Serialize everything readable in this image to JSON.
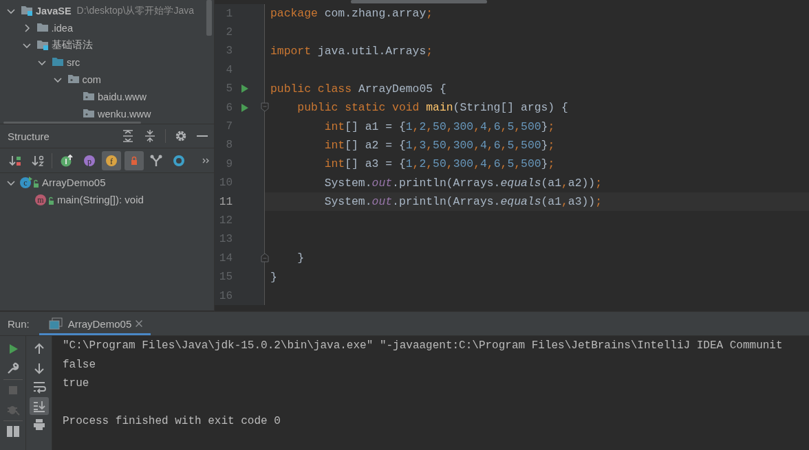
{
  "project_tree": {
    "items": [
      {
        "name": "JavaSE",
        "path": "D:\\desktop\\从零开始学Java",
        "kind": "module",
        "expanded": true,
        "children": [
          {
            "name": ".idea",
            "kind": "folder",
            "expanded": false
          },
          {
            "name": "基础语法",
            "kind": "module",
            "expanded": true,
            "children": [
              {
                "name": "src",
                "kind": "source",
                "expanded": true,
                "children": [
                  {
                    "name": "com",
                    "kind": "package",
                    "expanded": true,
                    "children": [
                      {
                        "name": "baidu.www",
                        "kind": "package"
                      },
                      {
                        "name": "wenku.www",
                        "kind": "package"
                      }
                    ]
                  }
                ]
              }
            ]
          }
        ]
      }
    ]
  },
  "structure": {
    "title": "Structure",
    "toolbar": [
      {
        "kind": "sort-visibility",
        "selected": false
      },
      {
        "kind": "sort-alpha",
        "selected": false
      },
      {
        "kind": "inherited",
        "selected": false
      },
      {
        "kind": "properties",
        "glyph": "p",
        "selected": false
      },
      {
        "kind": "fields",
        "glyph": "f",
        "selected": true
      },
      {
        "kind": "non-public",
        "selected": true
      },
      {
        "kind": "anonymous",
        "selected": false
      },
      {
        "kind": "lambdas",
        "selected": false
      }
    ],
    "tree": [
      {
        "name": "ArrayDemo05",
        "kind": "class",
        "glyph": "c",
        "expanded": true,
        "children": [
          {
            "name": "main(String[]): void",
            "kind": "method",
            "glyph": "m"
          }
        ]
      }
    ]
  },
  "editor": {
    "lines": [
      {
        "number": "1",
        "run": false,
        "current": false,
        "fold_start": false,
        "fold_end": false,
        "tokens": [
          {
            "kind": "keyword",
            "text": "package"
          },
          {
            "kind": "plain",
            "text": " com.zhang.array"
          },
          {
            "kind": "keyword",
            "text": ";"
          }
        ]
      },
      {
        "number": "2",
        "run": false,
        "current": false,
        "fold_start": false,
        "fold_end": false
      },
      {
        "number": "3",
        "run": false,
        "current": false,
        "fold_start": false,
        "fold_end": false,
        "tokens": [
          {
            "kind": "keyword",
            "text": "import"
          },
          {
            "kind": "plain",
            "text": " java.util.Arrays"
          },
          {
            "kind": "keyword",
            "text": ";"
          }
        ]
      },
      {
        "number": "4",
        "run": false,
        "current": false,
        "fold_start": false,
        "fold_end": false
      },
      {
        "number": "5",
        "run": true,
        "current": false,
        "fold_start": false,
        "fold_end": false,
        "tokens": [
          {
            "kind": "keyword",
            "text": "public class"
          },
          {
            "kind": "plain",
            "text": " ArrayDemo05 {"
          }
        ]
      },
      {
        "number": "6",
        "run": true,
        "current": false,
        "fold_start": true,
        "fold_end": false,
        "tokens": [
          {
            "kind": "keyword",
            "text": "    public static void "
          },
          {
            "kind": "declaration",
            "text": "main"
          },
          {
            "kind": "plain",
            "text": "(String[] args) {"
          }
        ]
      },
      {
        "number": "7",
        "run": false,
        "current": false,
        "fold_start": false,
        "fold_end": false,
        "tokens": [
          {
            "kind": "keyword",
            "text": "        int"
          },
          {
            "kind": "plain",
            "text": "[] a1 = {"
          },
          {
            "kind": "number",
            "text": "1"
          },
          {
            "kind": "keyword",
            "text": ","
          },
          {
            "kind": "number",
            "text": "2"
          },
          {
            "kind": "keyword",
            "text": ","
          },
          {
            "kind": "number",
            "text": "50"
          },
          {
            "kind": "keyword",
            "text": ","
          },
          {
            "kind": "number",
            "text": "300"
          },
          {
            "kind": "keyword",
            "text": ","
          },
          {
            "kind": "number",
            "text": "4"
          },
          {
            "kind": "keyword",
            "text": ","
          },
          {
            "kind": "number",
            "text": "6"
          },
          {
            "kind": "keyword",
            "text": ","
          },
          {
            "kind": "number",
            "text": "5"
          },
          {
            "kind": "keyword",
            "text": ","
          },
          {
            "kind": "number",
            "text": "500"
          },
          {
            "kind": "plain",
            "text": "}"
          },
          {
            "kind": "keyword",
            "text": ";"
          }
        ]
      },
      {
        "number": "8",
        "run": false,
        "current": false,
        "fold_start": false,
        "fold_end": false,
        "tokens": [
          {
            "kind": "keyword",
            "text": "        int"
          },
          {
            "kind": "plain",
            "text": "[] a2 = {"
          },
          {
            "kind": "number",
            "text": "1"
          },
          {
            "kind": "keyword",
            "text": ","
          },
          {
            "kind": "number",
            "text": "3"
          },
          {
            "kind": "keyword",
            "text": ","
          },
          {
            "kind": "number",
            "text": "50"
          },
          {
            "kind": "keyword",
            "text": ","
          },
          {
            "kind": "number",
            "text": "300"
          },
          {
            "kind": "keyword",
            "text": ","
          },
          {
            "kind": "number",
            "text": "4"
          },
          {
            "kind": "keyword",
            "text": ","
          },
          {
            "kind": "number",
            "text": "6"
          },
          {
            "kind": "keyword",
            "text": ","
          },
          {
            "kind": "number",
            "text": "5"
          },
          {
            "kind": "keyword",
            "text": ","
          },
          {
            "kind": "number",
            "text": "500"
          },
          {
            "kind": "plain",
            "text": "}"
          },
          {
            "kind": "keyword",
            "text": ";"
          }
        ]
      },
      {
        "number": "9",
        "run": false,
        "current": false,
        "fold_start": false,
        "fold_end": false,
        "tokens": [
          {
            "kind": "keyword",
            "text": "        int"
          },
          {
            "kind": "plain",
            "text": "[] a3 = {"
          },
          {
            "kind": "number",
            "text": "1"
          },
          {
            "kind": "keyword",
            "text": ","
          },
          {
            "kind": "number",
            "text": "2"
          },
          {
            "kind": "keyword",
            "text": ","
          },
          {
            "kind": "number",
            "text": "50"
          },
          {
            "kind": "keyword",
            "text": ","
          },
          {
            "kind": "number",
            "text": "300"
          },
          {
            "kind": "keyword",
            "text": ","
          },
          {
            "kind": "number",
            "text": "4"
          },
          {
            "kind": "keyword",
            "text": ","
          },
          {
            "kind": "number",
            "text": "6"
          },
          {
            "kind": "keyword",
            "text": ","
          },
          {
            "kind": "number",
            "text": "5"
          },
          {
            "kind": "keyword",
            "text": ","
          },
          {
            "kind": "number",
            "text": "500"
          },
          {
            "kind": "plain",
            "text": "}"
          },
          {
            "kind": "keyword",
            "text": ";"
          }
        ]
      },
      {
        "number": "10",
        "run": false,
        "current": false,
        "fold_start": false,
        "fold_end": false,
        "tokens": [
          {
            "kind": "plain",
            "text": "        System."
          },
          {
            "kind": "field",
            "text": "out"
          },
          {
            "kind": "plain",
            "text": ".println(Arrays."
          },
          {
            "kind": "static",
            "text": "equals"
          },
          {
            "kind": "plain",
            "text": "(a1"
          },
          {
            "kind": "keyword",
            "text": ","
          },
          {
            "kind": "plain",
            "text": "a2))"
          },
          {
            "kind": "keyword",
            "text": ";"
          }
        ]
      },
      {
        "number": "11",
        "run": false,
        "current": true,
        "fold_start": false,
        "fold_end": false,
        "tokens": [
          {
            "kind": "plain",
            "text": "        System."
          },
          {
            "kind": "field",
            "text": "out"
          },
          {
            "kind": "plain",
            "text": ".println(Arrays."
          },
          {
            "kind": "static",
            "text": "equals"
          },
          {
            "kind": "plain",
            "text": "(a1"
          },
          {
            "kind": "keyword",
            "text": ","
          },
          {
            "kind": "plain",
            "text": "a3))"
          },
          {
            "kind": "keyword",
            "text": ";"
          }
        ]
      },
      {
        "number": "12",
        "run": false,
        "current": false,
        "fold_start": false,
        "fold_end": false
      },
      {
        "number": "13",
        "run": false,
        "current": false,
        "fold_start": false,
        "fold_end": false
      },
      {
        "number": "14",
        "run": false,
        "current": false,
        "fold_start": false,
        "fold_end": true,
        "tokens": [
          {
            "kind": "plain",
            "text": "    }"
          }
        ]
      },
      {
        "number": "15",
        "run": false,
        "current": false,
        "fold_start": false,
        "fold_end": false,
        "tokens": [
          {
            "kind": "plain",
            "text": "}"
          }
        ]
      },
      {
        "number": "16",
        "run": false,
        "current": false,
        "fold_start": false,
        "fold_end": false
      }
    ]
  },
  "run_panel": {
    "label": "Run:",
    "tabs": [
      {
        "title": "ArrayDemo05",
        "selected": true
      }
    ],
    "side_toolbar": [
      {
        "kind": "rerun",
        "disabled": false
      },
      {
        "kind": "settings",
        "disabled": false
      },
      {
        "kind": "stop",
        "disabled": true
      },
      {
        "kind": "debug",
        "disabled": true
      },
      {
        "kind": "layout",
        "disabled": false
      }
    ],
    "console_toolbar": [
      {
        "kind": "up",
        "selected": false
      },
      {
        "kind": "down",
        "selected": false
      },
      {
        "kind": "wrap",
        "selected": false
      },
      {
        "kind": "scroll-end",
        "selected": true
      },
      {
        "kind": "print",
        "selected": false
      }
    ],
    "console": [
      {
        "text": "\"C:\\Program Files\\Java\\jdk-15.0.2\\bin\\java.exe\" \"-javaagent:C:\\Program Files\\JetBrains\\IntelliJ IDEA Communit",
        "blank_line_before": false
      },
      {
        "text": "false",
        "blank_line_before": false
      },
      {
        "text": "true",
        "blank_line_before": false
      },
      {
        "text": "Process finished with exit code 0",
        "blank_line_before": true
      }
    ]
  }
}
